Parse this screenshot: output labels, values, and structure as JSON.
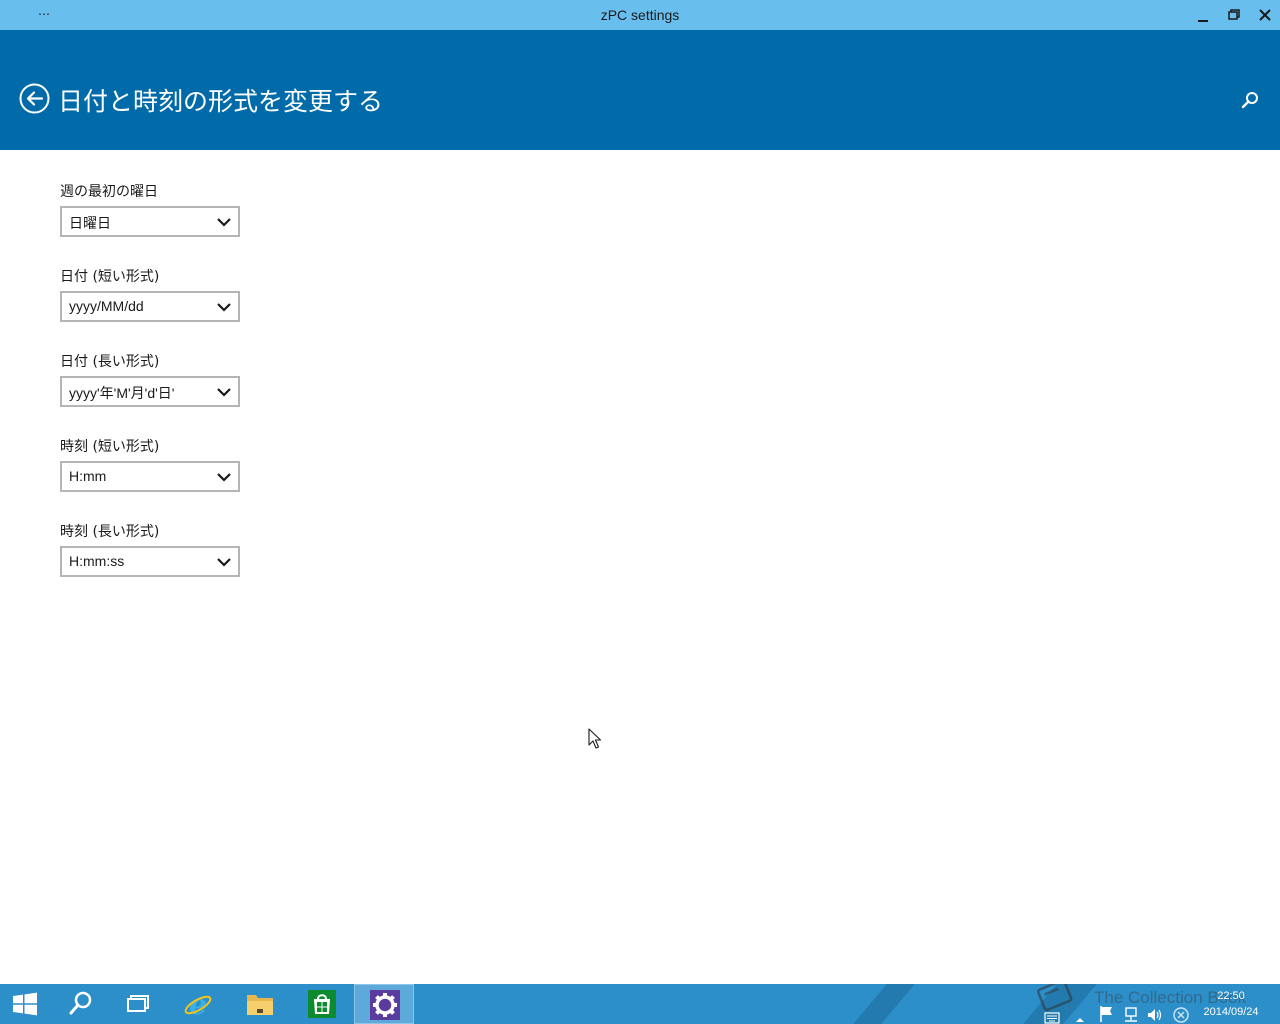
{
  "window": {
    "menu_label": "…",
    "title": "zPC settings"
  },
  "header": {
    "title": "日付と時刻の形式を変更する"
  },
  "settings": [
    {
      "label": "週の最初の曜日",
      "value": "日曜日"
    },
    {
      "label": "日付 (短い形式)",
      "value": "yyyy/MM/dd"
    },
    {
      "label": "日付 (長い形式)",
      "value": "yyyy'年'M'月'd'日'"
    },
    {
      "label": "時刻 (短い形式)",
      "value": "H:mm"
    },
    {
      "label": "時刻 (長い形式)",
      "value": "H:mm:ss"
    }
  ],
  "taskbar": {
    "items": [
      {
        "icon": "windows-start-icon"
      },
      {
        "icon": "search-icon"
      },
      {
        "icon": "task-view-icon"
      },
      {
        "icon": "internet-explorer-icon"
      },
      {
        "icon": "file-explorer-icon"
      },
      {
        "icon": "store-icon"
      },
      {
        "icon": "settings-gear-icon",
        "active": true
      }
    ],
    "tray_icons": [
      "keyboard-icon",
      "show-hidden-icons-chevron",
      "action-center-flag-icon",
      "network-icon",
      "volume-icon",
      "close-circle-icon"
    ],
    "watermark": "The Collection Book",
    "clock_time": "22:50",
    "clock_date": "2014/09/24"
  },
  "colors": {
    "titlebar": "#68bfee",
    "header": "#006ba8",
    "taskbar": "#2c8fc9"
  }
}
